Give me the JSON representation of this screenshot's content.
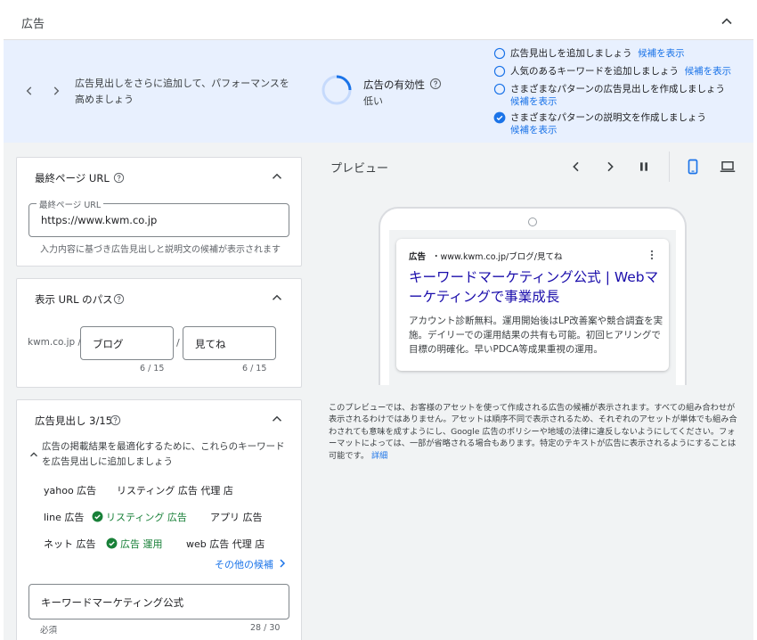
{
  "header": {
    "title": "広告"
  },
  "strength_banner": {
    "message": "広告見出しをさらに追加して、パフォーマンスを高めましょう",
    "label": "広告の有効性",
    "value": "低い",
    "value_fraction": 0.25,
    "suggestions": [
      {
        "text": "広告見出しを追加しましょう",
        "link": "候補を表示",
        "done": false
      },
      {
        "text": "人気のあるキーワードを追加しましょう",
        "link": "候補を表示",
        "done": false
      },
      {
        "text": "さまざまなパターンの広告見出しを作成しましょう",
        "link": "候補を表示",
        "done": false
      },
      {
        "text": "さまざまなパターンの説明文を作成しましょう",
        "link": "候補を表示",
        "done": true
      }
    ]
  },
  "final_url": {
    "title": "最終ページ URL",
    "field_label": "最終ページ URL",
    "value": "https://www.kwm.co.jp",
    "hint": "入力内容に基づき広告見出しと説明文の候補が表示されます"
  },
  "display_path": {
    "title": "表示 URL のパス",
    "domain": "kwm.co.jp /",
    "separator": "/",
    "path1": "ブログ",
    "path1_count": "6 / 15",
    "path2": "見てね",
    "path2_count": "6 / 15"
  },
  "headlines": {
    "title": "広告見出し 3/15",
    "tip": "広告の掲載結果を最適化するために、これらのキーワードを広告見出しに追加しましょう",
    "keywords": [
      {
        "text": "yahoo 広告",
        "added": false
      },
      {
        "text": "リスティング 広告 代理 店",
        "added": false
      },
      {
        "text": "line 広告",
        "added": false
      },
      {
        "text": "リスティング 広告",
        "added": true
      },
      {
        "text": "アプリ 広告",
        "added": false
      },
      {
        "text": "ネット 広告",
        "added": false
      },
      {
        "text": "広告 運用",
        "added": true
      },
      {
        "text": "web 広告 代理 店",
        "added": false
      }
    ],
    "more_link": "その他の候補",
    "input_value": "キーワードマーケティング公式",
    "required": "必須",
    "counter": "28 / 30"
  },
  "preview": {
    "title": "プレビュー",
    "ad": {
      "label": "広告",
      "url": "・www.kwm.co.jp/ブログ/見てね",
      "headline": "キーワードマーケティング公式 | Webマーケティングで事業成長",
      "description": "アカウント診断無料。運用開始後はLP改善案や競合調査を実施。デイリーでの運用結果の共有も可能。初回ヒアリングで目標の明確化。早いPDCA等成果重視の運用。"
    },
    "note": "このプレビューでは、お客様のアセットを使って作成される広告の候補が表示されます。すべての組み合わせが表示されるわけではありません。アセットは順序不同で表示されるため、それぞれのアセットが単体でも組み合わされても意味を成すようにし、Google 広告のポリシーや地域の法律に違反しないようにしてください。フォーマットによっては、一部が省略される場合もあります。特定のテキストが広告に表示されるようにすることは可能です。",
    "note_link": "詳細"
  },
  "colors": {
    "accent": "#1a73e8",
    "banner_bg": "#e8f0fe",
    "panel_bg": "#f1f3f4",
    "success": "#188038",
    "ad_title": "#1a0dab"
  }
}
